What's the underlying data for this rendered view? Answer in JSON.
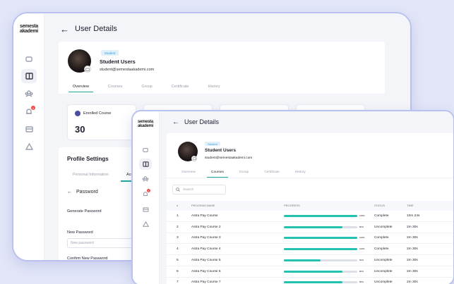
{
  "back_window": {
    "logo_line1": "semesta",
    "logo_line2": "akademi",
    "title": "User Details",
    "user": {
      "badge": "Student",
      "name": "Student Users",
      "email": "student@semestaakademi.com"
    },
    "tabs": [
      "Overview",
      "Courses",
      "Group",
      "Certificate",
      "History"
    ],
    "active_tab": "Overview",
    "stat": {
      "label": "Enrolled Course",
      "value": "30"
    },
    "profile_settings": {
      "heading": "Profile Settings",
      "subtabs": [
        "Personal Information",
        "Acc"
      ],
      "password_heading": "Password",
      "generate_label": "Generate Password",
      "new_label": "New Password",
      "new_placeholder": "New password",
      "confirm_label": "Confirm New Password"
    },
    "notification_count": "1"
  },
  "front_window": {
    "logo_line1": "semesta",
    "logo_line2": "akademi",
    "title": "User Details",
    "user": {
      "badge": "Student",
      "name": "Student Users",
      "email": "student@semestaakademi.com"
    },
    "tabs": [
      "Overview",
      "Courses",
      "Group",
      "Certificate",
      "History"
    ],
    "active_tab": "Courses",
    "search_placeholder": "Search",
    "table": {
      "headers": [
        "#",
        "PROGRAM NAME",
        "PROGRESS",
        "STATUS",
        "TIME"
      ],
      "rows": [
        {
          "n": "1",
          "name": "Astra Pay Course",
          "progress": 100,
          "progress_label": "100%",
          "status": "Complete",
          "time": "10m 24s"
        },
        {
          "n": "2",
          "name": "Astra Pay Course 2",
          "progress": 80,
          "progress_label": "80%",
          "status": "Uncomplete",
          "time": "2m 30s"
        },
        {
          "n": "3",
          "name": "Astra Pay Course 3",
          "progress": 100,
          "progress_label": "100%",
          "status": "Complete",
          "time": "2m 30s"
        },
        {
          "n": "4",
          "name": "Astra Pay Course 4",
          "progress": 100,
          "progress_label": "100%",
          "status": "Complete",
          "time": "2m 30s"
        },
        {
          "n": "5",
          "name": "Astra Pay Course 5",
          "progress": 50,
          "progress_label": "50%",
          "status": "Uncomplete",
          "time": "2m 30s"
        },
        {
          "n": "6",
          "name": "Astra Pay Course 6",
          "progress": 80,
          "progress_label": "80%",
          "status": "Uncomplete",
          "time": "2m 30s"
        },
        {
          "n": "7",
          "name": "Astra Pay Course 7",
          "progress": 80,
          "progress_label": "80%",
          "status": "Uncomplete",
          "time": "2m 30s"
        }
      ]
    },
    "notification_count": "1"
  },
  "colors": {
    "accent": "#22c1b0",
    "badge_bg": "#dff0fb",
    "badge_text": "#3aa0d6",
    "frame": "#b9c1ef",
    "course_dot": "#4a4fa3"
  },
  "icons": [
    "back-arrow-icon",
    "book-icon",
    "dashboard-icon",
    "users-icon",
    "bell-icon",
    "card-icon",
    "hierarchy-icon",
    "camera-icon",
    "search-icon"
  ]
}
